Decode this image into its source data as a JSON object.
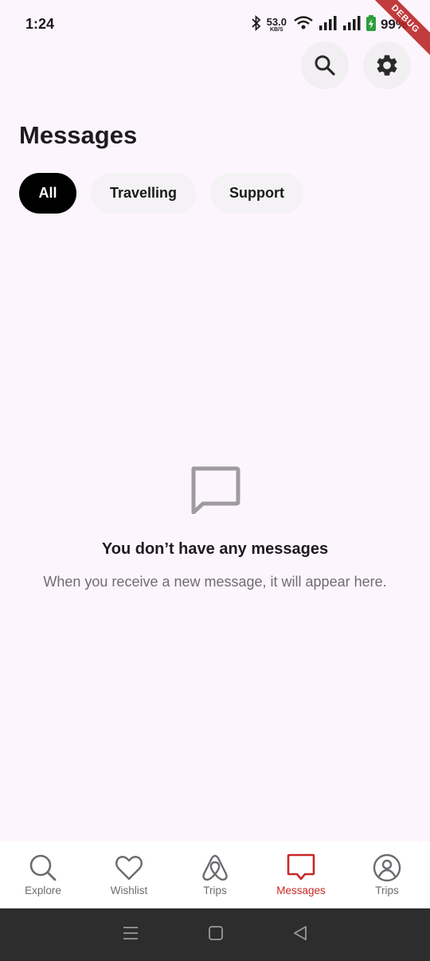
{
  "status_bar": {
    "time": "1:24",
    "net_speed_value": "53.0",
    "net_speed_unit": "KB/S",
    "battery": "99%",
    "debug_banner": "DEBUG"
  },
  "header": {
    "title": "Messages"
  },
  "filters": {
    "chips": [
      {
        "label": "All",
        "active": true
      },
      {
        "label": "Travelling",
        "active": false
      },
      {
        "label": "Support",
        "active": false
      }
    ]
  },
  "empty_state": {
    "icon": "message-icon",
    "title": "You don’t have any messages",
    "subtitle": "When you receive a new message, it will appear here."
  },
  "bottom_nav": {
    "items": [
      {
        "label": "Explore",
        "icon": "search-icon",
        "active": false
      },
      {
        "label": "Wishlist",
        "icon": "heart-icon",
        "active": false
      },
      {
        "label": "Trips",
        "icon": "airbnb-logo-icon",
        "active": false
      },
      {
        "label": "Messages",
        "icon": "message-icon",
        "active": true
      },
      {
        "label": "Trips",
        "icon": "profile-icon",
        "active": false
      }
    ]
  },
  "colors": {
    "background": "#fdf5fd",
    "accent": "#c62828",
    "chip_active": "#000000",
    "chip_inactive": "#f4f2f4"
  }
}
